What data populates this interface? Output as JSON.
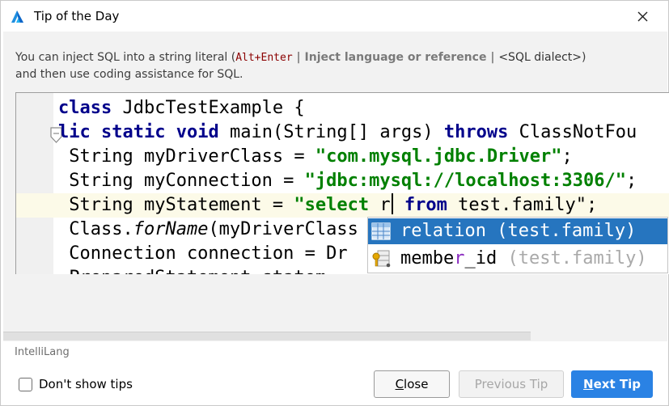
{
  "window": {
    "title": "Tip of the Day",
    "icon": "intellij-app-icon",
    "close_icon": "close-icon"
  },
  "tip": {
    "text_before": "You can inject SQL into a string literal (",
    "shortcut": "Alt+Enter",
    "separator1": " | ",
    "action": "Inject language or reference",
    "separator2": " | ",
    "dialect": "<SQL dialect>",
    "text_after_paren": ")",
    "text_line2": "and then use coding assistance for SQL."
  },
  "code": {
    "line1": {
      "kw": "class",
      "rest": " JdbcTestExample {"
    },
    "line2": {
      "kw1": "lic",
      "kw2": "static",
      "kw3": "void",
      "mid": " main(String[] args) ",
      "kw4": "throws",
      "rest": " ClassNotFou"
    },
    "line3": {
      "pre": " String myDriverClass = ",
      "str": "\"com.mysql.jdbc.Driver\"",
      "post": ";"
    },
    "line4": {
      "pre": " String myConnection = ",
      "str": "\"jdbc:mysql://localhost:3306/\"",
      "post": ";"
    },
    "line5": {
      "pre": " String myStatement = ",
      "str_open": "\"select ",
      "typed": "r",
      "sql_kw": " from",
      "sql_rest": " test.family\"",
      "post": ";"
    },
    "line6": {
      "pre": " Class.",
      "method": "forName",
      "post": "(myDriverClass"
    },
    "line7": {
      "pre": " Connection connection = Dr"
    },
    "line8": {
      "pre": " PreparedStatement statem"
    }
  },
  "completion": {
    "items": [
      {
        "icon": "table-icon",
        "name": "relation",
        "hint": " (test.family)",
        "selected": true
      },
      {
        "icon": "key-column-icon",
        "name_pre": "membe",
        "name_match": "r",
        "name_post": "_id",
        "hint": " (test.family)",
        "selected": false
      }
    ]
  },
  "footer": {
    "plugin": "IntelliLang",
    "dont_show_label": "Don't show tips",
    "dont_show_checked": false,
    "close_label_u": "C",
    "close_label_rest": "lose",
    "prev_label": "Previous Tip",
    "next_label_u": "N",
    "next_label_rest": "ext Tip"
  },
  "colors": {
    "accent": "#2a82e4",
    "selection": "#2675bf",
    "keyword": "#00008b",
    "string": "#008000"
  }
}
